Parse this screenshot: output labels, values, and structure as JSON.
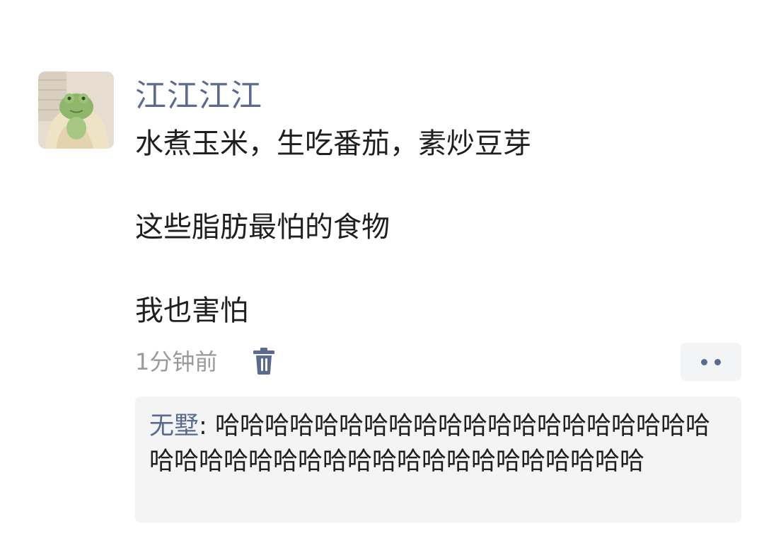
{
  "comment": {
    "author": "江江江江",
    "avatar_icon": "frog-avatar",
    "lines": [
      "水煮玉米，生吃番茄，素炒豆芽",
      "这些脂肪最怕的食物",
      "我也害怕"
    ],
    "time": "1分钟前",
    "delete_icon": "trash-icon",
    "more_icon": "more-dots-icon"
  },
  "reply": {
    "author": "无墅",
    "separator": ": ",
    "text": "哈哈哈哈哈哈哈哈哈哈哈哈哈哈哈哈哈哈哈哈哈哈哈哈哈哈哈哈哈哈哈哈哈哈哈哈哈哈哈哈"
  },
  "colors": {
    "name_blue": "#5a6b8f",
    "text": "#1f1f1f",
    "muted": "#9a9a9a",
    "reply_bg": "#f4f4f4"
  }
}
